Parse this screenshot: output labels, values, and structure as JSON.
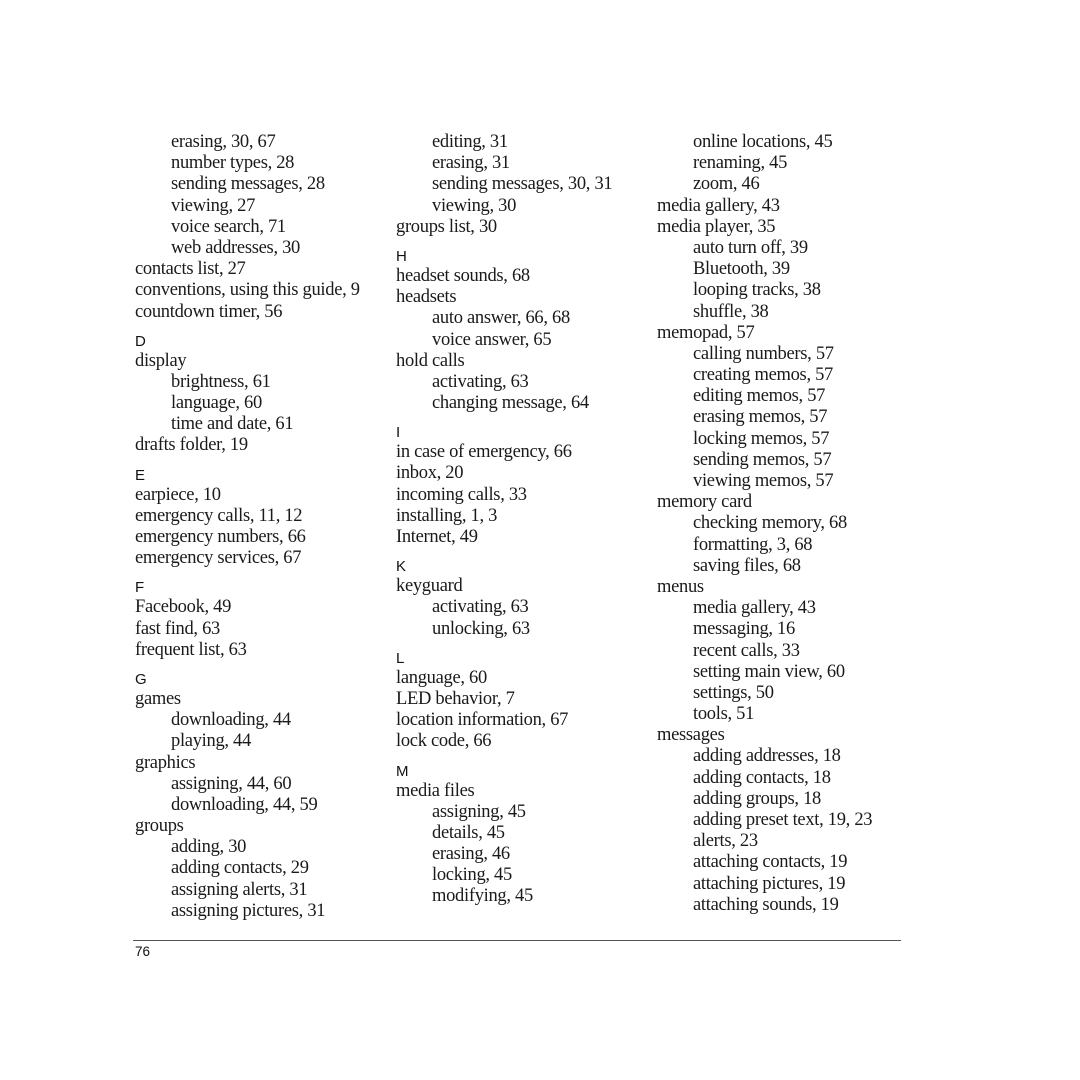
{
  "page_number": "76",
  "columns": [
    [
      {
        "t": "sub",
        "text": "erasing, 30, 67"
      },
      {
        "t": "sub",
        "text": "number types, 28"
      },
      {
        "t": "sub",
        "text": "sending messages, 28"
      },
      {
        "t": "sub",
        "text": "viewing, 27"
      },
      {
        "t": "sub",
        "text": "voice search, 71"
      },
      {
        "t": "sub",
        "text": "web addresses, 30"
      },
      {
        "t": "main",
        "text": "contacts list, 27"
      },
      {
        "t": "main",
        "text": "conventions, using this guide, 9"
      },
      {
        "t": "main",
        "text": "countdown timer, 56"
      },
      {
        "t": "letter",
        "text": "D"
      },
      {
        "t": "main",
        "text": "display"
      },
      {
        "t": "sub",
        "text": "brightness, 61"
      },
      {
        "t": "sub",
        "text": "language, 60"
      },
      {
        "t": "sub",
        "text": "time and date, 61"
      },
      {
        "t": "main",
        "text": "drafts folder, 19"
      },
      {
        "t": "letter",
        "text": "E"
      },
      {
        "t": "main",
        "text": "earpiece, 10"
      },
      {
        "t": "main",
        "text": "emergency calls, 11, 12"
      },
      {
        "t": "main",
        "text": "emergency numbers, 66"
      },
      {
        "t": "main",
        "text": "emergency services, 67"
      },
      {
        "t": "letter",
        "text": "F"
      },
      {
        "t": "main",
        "text": "Facebook, 49"
      },
      {
        "t": "main",
        "text": "fast find, 63"
      },
      {
        "t": "main",
        "text": "frequent list, 63"
      },
      {
        "t": "letter",
        "text": "G"
      },
      {
        "t": "main",
        "text": "games"
      },
      {
        "t": "sub",
        "text": "downloading, 44"
      },
      {
        "t": "sub",
        "text": "playing, 44"
      },
      {
        "t": "main",
        "text": "graphics"
      },
      {
        "t": "sub",
        "text": "assigning, 44, 60"
      },
      {
        "t": "sub",
        "text": "downloading, 44, 59"
      },
      {
        "t": "main",
        "text": "groups"
      },
      {
        "t": "sub",
        "text": "adding, 30"
      },
      {
        "t": "sub",
        "text": "adding contacts, 29"
      },
      {
        "t": "sub",
        "text": "assigning alerts, 31"
      },
      {
        "t": "sub",
        "text": "assigning pictures, 31"
      }
    ],
    [
      {
        "t": "sub",
        "text": "editing, 31"
      },
      {
        "t": "sub",
        "text": "erasing, 31"
      },
      {
        "t": "sub",
        "text": "sending messages, 30, 31"
      },
      {
        "t": "sub",
        "text": "viewing, 30"
      },
      {
        "t": "main",
        "text": "groups list, 30"
      },
      {
        "t": "letter",
        "text": "H"
      },
      {
        "t": "main",
        "text": "headset sounds, 68"
      },
      {
        "t": "main",
        "text": "headsets"
      },
      {
        "t": "sub",
        "text": "auto answer, 66, 68"
      },
      {
        "t": "sub",
        "text": "voice answer, 65"
      },
      {
        "t": "main",
        "text": "hold calls"
      },
      {
        "t": "sub",
        "text": "activating, 63"
      },
      {
        "t": "sub",
        "text": "changing message, 64"
      },
      {
        "t": "letter",
        "text": "I"
      },
      {
        "t": "main",
        "text": "in case of emergency, 66"
      },
      {
        "t": "main",
        "text": "inbox, 20"
      },
      {
        "t": "main",
        "text": "incoming calls, 33"
      },
      {
        "t": "main",
        "text": "installing, 1, 3"
      },
      {
        "t": "main",
        "text": "Internet, 49"
      },
      {
        "t": "letter",
        "text": "K"
      },
      {
        "t": "main",
        "text": "keyguard"
      },
      {
        "t": "sub",
        "text": "activating, 63"
      },
      {
        "t": "sub",
        "text": "unlocking, 63"
      },
      {
        "t": "letter",
        "text": "L"
      },
      {
        "t": "main",
        "text": "language, 60"
      },
      {
        "t": "main",
        "text": "LED behavior, 7"
      },
      {
        "t": "main",
        "text": "location information, 67"
      },
      {
        "t": "main",
        "text": "lock code, 66"
      },
      {
        "t": "letter",
        "text": "M"
      },
      {
        "t": "main",
        "text": "media files"
      },
      {
        "t": "sub",
        "text": "assigning, 45"
      },
      {
        "t": "sub",
        "text": "details, 45"
      },
      {
        "t": "sub",
        "text": "erasing, 46"
      },
      {
        "t": "sub",
        "text": "locking, 45"
      },
      {
        "t": "sub",
        "text": "modifying, 45"
      }
    ],
    [
      {
        "t": "sub",
        "text": "online locations, 45"
      },
      {
        "t": "sub",
        "text": "renaming, 45"
      },
      {
        "t": "sub",
        "text": "zoom, 46"
      },
      {
        "t": "main",
        "text": "media gallery, 43"
      },
      {
        "t": "main",
        "text": "media player, 35"
      },
      {
        "t": "sub",
        "text": "auto turn off, 39"
      },
      {
        "t": "sub",
        "text": "Bluetooth, 39"
      },
      {
        "t": "sub",
        "text": "looping tracks, 38"
      },
      {
        "t": "sub",
        "text": "shuffle, 38"
      },
      {
        "t": "main",
        "text": "memopad, 57"
      },
      {
        "t": "sub",
        "text": "calling numbers, 57"
      },
      {
        "t": "sub",
        "text": "creating memos, 57"
      },
      {
        "t": "sub",
        "text": "editing memos, 57"
      },
      {
        "t": "sub",
        "text": "erasing memos, 57"
      },
      {
        "t": "sub",
        "text": "locking memos, 57"
      },
      {
        "t": "sub",
        "text": "sending memos, 57"
      },
      {
        "t": "sub",
        "text": "viewing memos, 57"
      },
      {
        "t": "main",
        "text": "memory card"
      },
      {
        "t": "sub",
        "text": "checking memory, 68"
      },
      {
        "t": "sub",
        "text": "formatting, 3, 68"
      },
      {
        "t": "sub",
        "text": "saving files, 68"
      },
      {
        "t": "main",
        "text": "menus"
      },
      {
        "t": "sub",
        "text": "media gallery, 43"
      },
      {
        "t": "sub",
        "text": "messaging, 16"
      },
      {
        "t": "sub",
        "text": "recent calls, 33"
      },
      {
        "t": "sub",
        "text": "setting main view, 60"
      },
      {
        "t": "sub",
        "text": "settings, 50"
      },
      {
        "t": "sub",
        "text": "tools, 51"
      },
      {
        "t": "main",
        "text": "messages"
      },
      {
        "t": "sub",
        "text": "adding addresses, 18"
      },
      {
        "t": "sub",
        "text": "adding contacts, 18"
      },
      {
        "t": "sub",
        "text": "adding groups, 18"
      },
      {
        "t": "sub",
        "text": "adding preset text, 19, 23"
      },
      {
        "t": "sub",
        "text": "alerts, 23"
      },
      {
        "t": "sub",
        "text": "attaching contacts, 19"
      },
      {
        "t": "sub",
        "text": "attaching pictures, 19"
      },
      {
        "t": "sub",
        "text": "attaching sounds, 19"
      }
    ]
  ]
}
